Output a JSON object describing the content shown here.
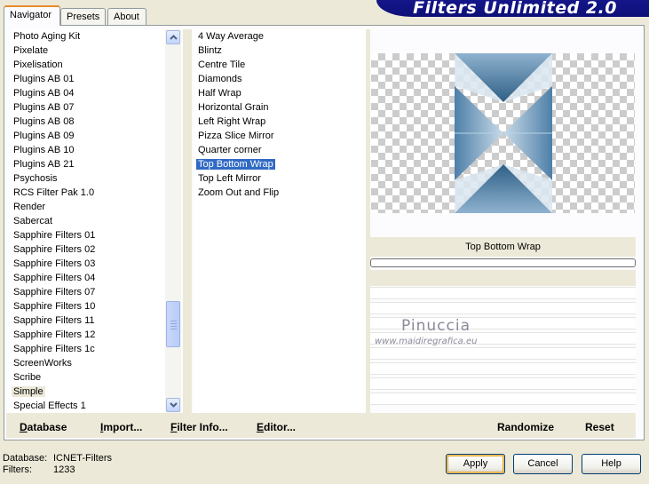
{
  "tabs": [
    {
      "label": "Navigator",
      "active": true
    },
    {
      "label": "Presets",
      "active": false
    },
    {
      "label": "About",
      "active": false
    }
  ],
  "banner": {
    "title": "Filters Unlimited 2.0"
  },
  "categories": [
    "Photo Aging Kit",
    "Pixelate",
    "Pixelisation",
    "Plugins AB 01",
    "Plugins AB 04",
    "Plugins AB 07",
    "Plugins AB 08",
    "Plugins AB 09",
    "Plugins AB 10",
    "Plugins AB 21",
    "Psychosis",
    "RCS Filter Pak 1.0",
    "Render",
    "Sabercat",
    "Sapphire Filters 01",
    "Sapphire Filters 02",
    "Sapphire Filters 03",
    "Sapphire Filters 04",
    "Sapphire Filters 07",
    "Sapphire Filters 10",
    "Sapphire Filters 11",
    "Sapphire Filters 12",
    "Sapphire Filters 1c",
    "ScreenWorks",
    "Scribe",
    "Simple",
    "Special Effects 1"
  ],
  "selected_category": "Simple",
  "filters": [
    "4 Way Average",
    "Blintz",
    "Centre Tile",
    "Diamonds",
    "Half Wrap",
    "Horizontal Grain",
    "Left Right Wrap",
    "Pizza Slice Mirror",
    "Quarter corner",
    "Top Bottom Wrap",
    "Top Left Mirror",
    "Zoom Out and Flip"
  ],
  "selected_filter": "Top Bottom Wrap",
  "preview": {
    "parameter_label": "Top Bottom Wrap"
  },
  "watermark": {
    "name": "Pinuccia",
    "url": "www.maidiregrafica.eu"
  },
  "left_buttons": [
    {
      "label": "Database",
      "underline": "D"
    },
    {
      "label": "Import...",
      "underline": "I"
    },
    {
      "label": "Filter Info...",
      "underline": "F"
    },
    {
      "label": "Editor...",
      "underline": "E"
    }
  ],
  "right_buttons": [
    {
      "label": "Randomize"
    },
    {
      "label": "Reset"
    }
  ],
  "status": {
    "database_label": "Database:",
    "database_value": "ICNET-Filters",
    "filters_label": "Filters:",
    "filters_value": "1233"
  },
  "dialog_buttons": {
    "apply": "Apply",
    "cancel": "Cancel",
    "help": "Help"
  },
  "colors": {
    "selection": "#316ac5",
    "banner": "#14168a",
    "preview_blue": "#3a6e99"
  }
}
